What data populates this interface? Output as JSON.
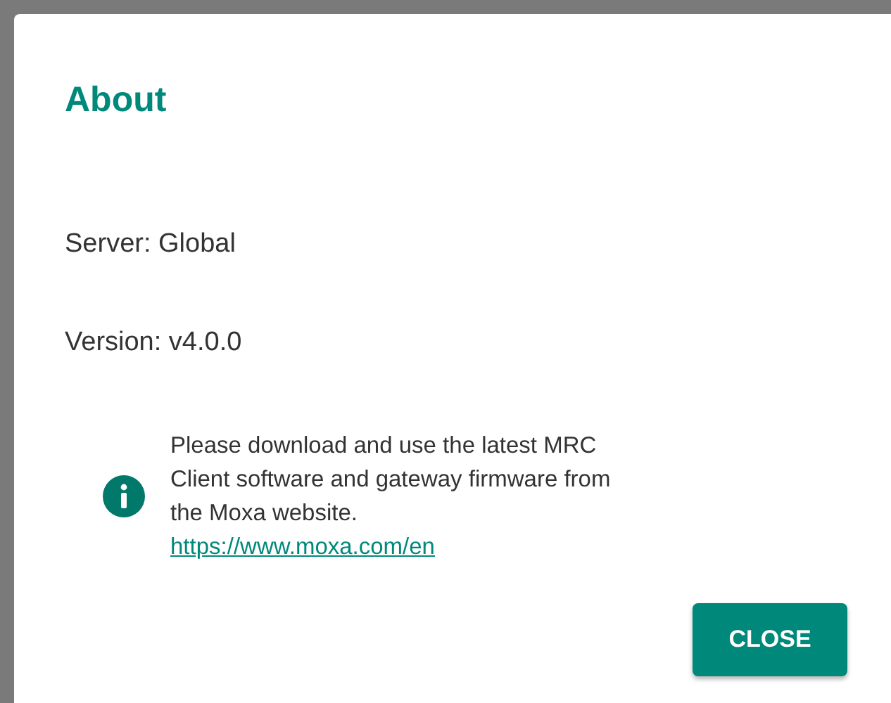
{
  "dialog": {
    "title": "About",
    "fields": [
      "Server: Global",
      "Version: v4.0.0"
    ],
    "notice": {
      "text": "Please download and use the latest MRC Client software and gateway firmware from the Moxa website.",
      "link": "https://www.moxa.com/en"
    },
    "buttons": [
      "CLOSE"
    ]
  }
}
